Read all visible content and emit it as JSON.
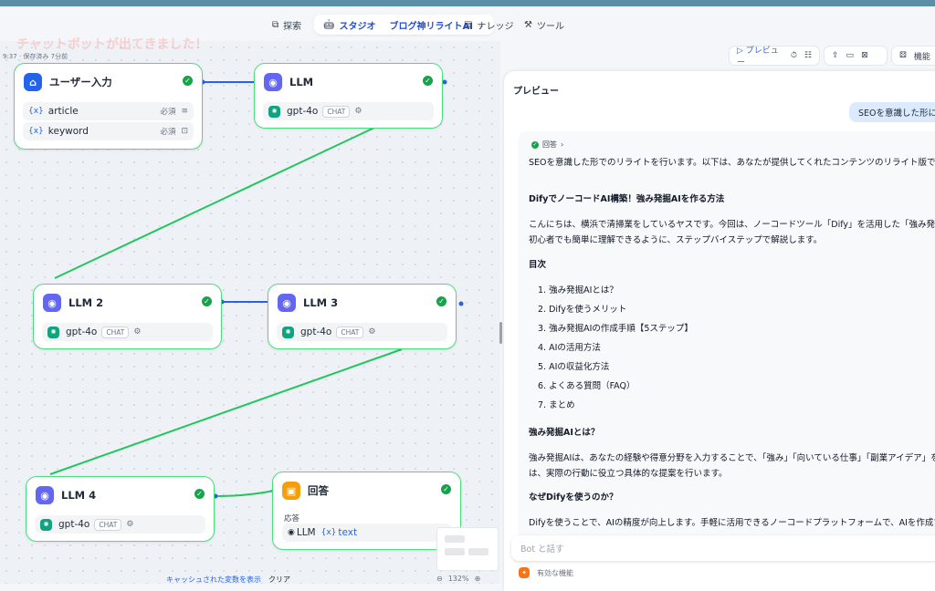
{
  "topnav": {
    "explore": "探索",
    "studio": "スタジオ",
    "app_name": "ブログ神リライトAI",
    "knowledge": "ナレッジ",
    "tools": "ツール"
  },
  "canvas": {
    "ghost_title": "チャットボットが出てきました！",
    "status": "9:37 · 保存済み 7分前",
    "zoom": "132%",
    "cache_link": "キャッシュされた変数を表示",
    "clear": "クリア"
  },
  "nodes": {
    "start": {
      "title": "ユーザー入力",
      "vars": [
        {
          "name": "article",
          "req": "必須"
        },
        {
          "name": "keyword",
          "req": "必須"
        }
      ]
    },
    "llm1": {
      "title": "LLM",
      "model": "gpt-4o",
      "mode": "CHAT"
    },
    "llm2": {
      "title": "LLM 2",
      "model": "gpt-4o",
      "mode": "CHAT"
    },
    "llm3": {
      "title": "LLM 3",
      "model": "gpt-4o",
      "mode": "CHAT"
    },
    "llm4": {
      "title": "LLM 4",
      "model": "gpt-4o",
      "mode": "CHAT"
    },
    "answer": {
      "title": "回答",
      "label": "応答",
      "source": "LLM",
      "var": "text"
    }
  },
  "toolbar": {
    "preview": "プレビュー",
    "features": "機能"
  },
  "preview": {
    "title": "プレビュー",
    "user_message": "SEOを意識した形にリ",
    "answer_tag": "回答",
    "lines": [
      "SEOを意識した形でのリライトを行います。以下は、あなたが提供してくれたコンテンツのリライト版です：",
      "DifyでノーコードAI構築！強み発掘AIを作る方法",
      "こんにちは、横浜で清掃業をしているヤスです。今回は、ノーコードツール「Dify」を活用した「強み発掘AI」の作成方法を",
      "初心者でも簡単に理解できるように、ステップバイステップで解説します。",
      "目次",
      "1. 強み発掘AIとは？",
      "2. Difyを使うメリット",
      "3. 強み発掘AIの作成手順【5ステップ】",
      "4. AIの活用方法",
      "5. AIの収益化方法",
      "6. よくある質問（FAQ）",
      "7. まとめ",
      "強み発掘AIとは？",
      "強み発掘AIは、あなたの経験や得意分野を入力することで、「強み」「向いている仕事」「副業アイデア」を提案するAIで",
      "は、実際の行動に役立つ具体的な提案を行います。",
      "なぜDifyを使うのか？",
      "Difyを使うことで、AIの精度が向上します。手軽に活用できるノーコードプラットフォームで、AIを作成するプロセスを簡単に"
    ],
    "input_placeholder": "Bot と話す",
    "feature_bar": "有効な機能"
  }
}
